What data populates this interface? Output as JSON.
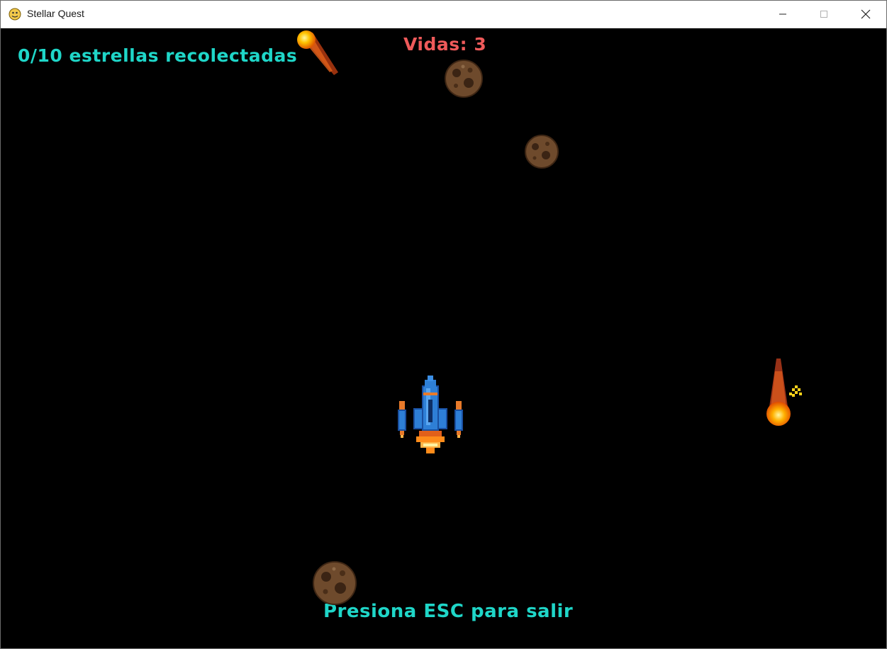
{
  "window": {
    "title": "Stellar Quest"
  },
  "hud": {
    "stars_collected": "0/10 estrellas recolectadas",
    "lives": "Vidas: 3",
    "exit_hint": "Presiona ESC para salir"
  },
  "colors": {
    "background": "#000000",
    "hud_primary": "#1fd6c8",
    "hud_lives": "#ef5a5a",
    "ship_body": "#2e7fd6",
    "flame": "#ff8c1a"
  },
  "sprites": {
    "player": "spaceship-icon",
    "asteroids": [
      "asteroid-icon",
      "asteroid-icon",
      "asteroid-icon"
    ],
    "comets": [
      "comet-icon",
      "comet-icon"
    ]
  }
}
